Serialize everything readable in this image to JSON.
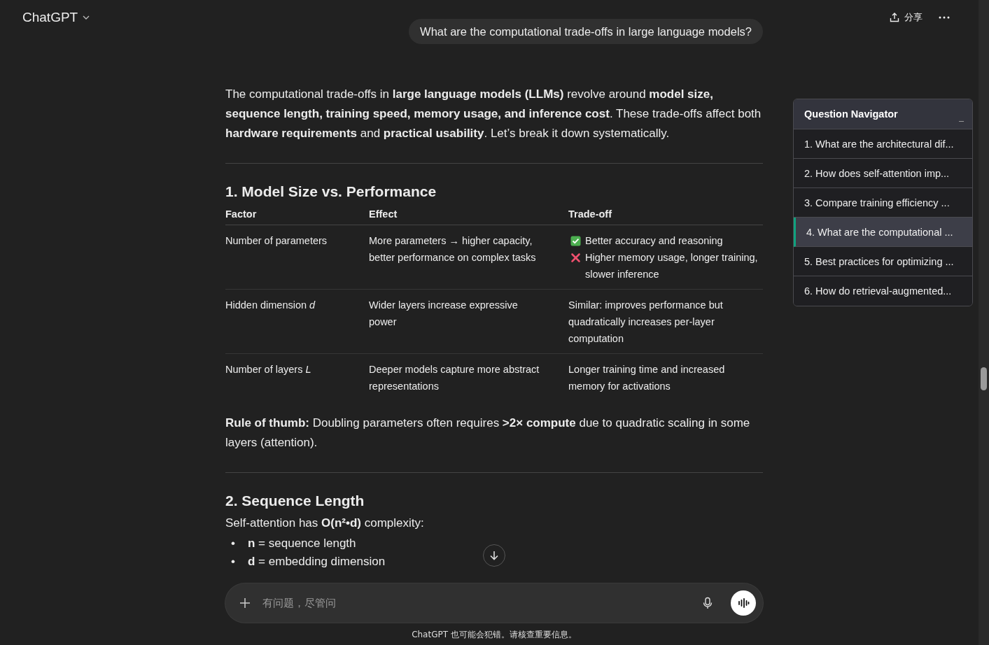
{
  "header": {
    "model": "ChatGPT",
    "share": "分享"
  },
  "user_message": "What are the computational trade-offs in large language models?",
  "intro": "The computational trade-offs in **large language models (LLMs)** revolve around **model size, sequence length, training speed, memory usage, and inference cost**. These trade-offs affect both **hardware requirements** and **practical usability**. Let’s break it down systematically.",
  "sections": [
    {
      "heading": "1. Model Size vs. Performance",
      "table": {
        "columns": [
          "Factor",
          "Effect",
          "Trade-off"
        ],
        "rows": [
          {
            "factor": "Number of parameters",
            "effect": "More parameters → higher capacity, better performance on complex tasks",
            "trade_off": [
              {
                "kind": "pro",
                "text": "Better accuracy and reasoning"
              },
              {
                "kind": "con",
                "text": "Higher memory usage, longer training, slower inference"
              }
            ]
          },
          {
            "factor": "Hidden dimension *d*",
            "effect": "Wider layers increase expressive power",
            "trade_off": [
              {
                "kind": "plain",
                "text": "Similar: improves performance but quadratically increases per-layer computation"
              }
            ]
          },
          {
            "factor": "Number of layers *L*",
            "effect": "Deeper models capture more abstract representations",
            "trade_off": [
              {
                "kind": "plain",
                "text": "Longer training time and increased memory for activations"
              }
            ]
          }
        ]
      },
      "note": "**Rule of thumb:** Doubling parameters often requires **>2× compute** due to quadratic scaling in some layers (attention)."
    },
    {
      "heading": "2. Sequence Length",
      "text": "Self-attention has **O(n²•d)** complexity:",
      "bullets": [
        {
          "marker": "•",
          "text": "**n** = sequence length"
        },
        {
          "marker": "•",
          "text": "**d** = embedding dimension"
        }
      ]
    }
  ],
  "navigator": {
    "title": "Question Navigator",
    "minimize": "_",
    "items": [
      {
        "label": "1. What are the architectural dif...",
        "selected": false
      },
      {
        "label": "2. How does self-attention imp...",
        "selected": false
      },
      {
        "label": "3. Compare training efficiency ...",
        "selected": false
      },
      {
        "label": "4. What are the computational ...",
        "selected": true
      },
      {
        "label": "5. Best practices for optimizing ...",
        "selected": false
      },
      {
        "label": "6. How do retrieval-augmented...",
        "selected": false
      }
    ]
  },
  "composer": {
    "placeholder": "有问题，尽管问"
  },
  "disclaimer": "ChatGPT 也可能会犯错。请核查重要信息。"
}
